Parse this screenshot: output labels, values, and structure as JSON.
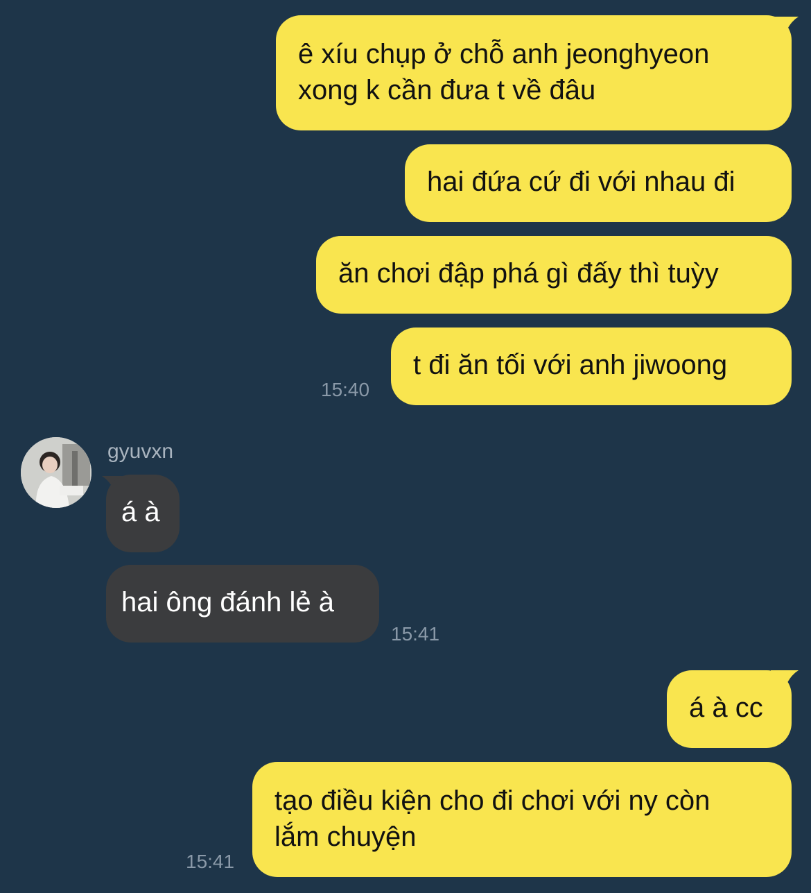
{
  "chat": {
    "messages_out_1": [
      "ê xíu chụp ở chỗ anh jeonghyeon\nxong k cần đưa t về đâu",
      "hai đứa cứ đi với nhau đi",
      "ăn chơi đập phá gì đấy thì tuỳy",
      "t đi ăn tối với anh jiwoong"
    ],
    "time_out_1": "15:40",
    "sender": "gyuvxn",
    "messages_in": [
      "á à",
      "hai ông đánh lẻ à"
    ],
    "time_in": "15:41",
    "messages_out_2": [
      "á à cc",
      "tạo điều kiện cho đi chơi với ny còn\nlắm chuyện"
    ],
    "time_out_2": "15:41"
  },
  "colors": {
    "background": "#1e3549",
    "outgoing_bubble": "#f9e54f",
    "incoming_bubble": "#3b3c3e",
    "timestamp": "#8a99a8"
  },
  "icons": {
    "avatar": "avatar-photo"
  }
}
